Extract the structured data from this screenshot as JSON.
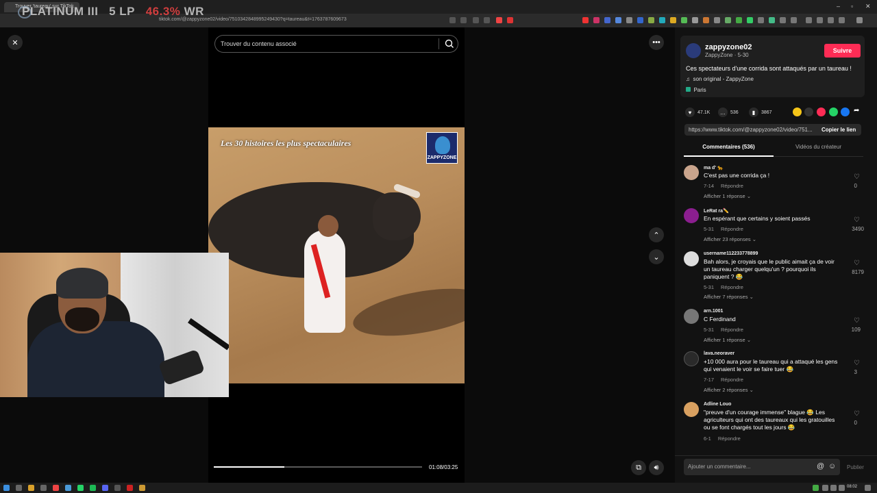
{
  "browser": {
    "tab_title": "Trouver 'taureau' sur TikTok",
    "url": "tiktok.com/@zappyzone02/video/7510342848995249430?q=taureau&t=1763787609673"
  },
  "stream_overlay": {
    "rank": "PLATINUM III",
    "lp": "5 LP",
    "wr_value": "46.3%",
    "wr_label": "WR"
  },
  "player": {
    "search_placeholder": "Trouver du contenu associé",
    "video_title": "Les 30 histoires les plus spectaculaires",
    "video_logo": "ZAPPYZONE",
    "time": "01:08/03:25",
    "progress": 0.34,
    "colors": {
      "accent": "#fe2c55",
      "background": "#000000"
    }
  },
  "post": {
    "author": "zappyzone02",
    "author_sub": "ZappyZone · 5-30",
    "follow_label": "Suivre",
    "description": "Ces spectateurs d'une corrida sont attaqués par un taureau !",
    "music": "son original - ZappyZone",
    "location": "Paris",
    "likes": "47.1K",
    "comments": "536",
    "saves": "3867",
    "link": "https://www.tiktok.com/@zappyzone02/video/751...",
    "copy_label": "Copier le lien"
  },
  "tabs": {
    "comments": "Commentaires (536)",
    "creator": "Vidéos du créateur"
  },
  "comments": [
    {
      "user": "ma d' 🐆",
      "text": "C'est pas une corrida ça !",
      "date": "7-14",
      "reply": "Répondre",
      "more": "Afficher 1 réponse ⌄",
      "likes": "0"
    },
    {
      "user": "LeRat ra✏️",
      "text": "En espérant que certains y soient passés",
      "date": "5-31",
      "reply": "Répondre",
      "more": "Afficher 23 réponses ⌄",
      "likes": "3490"
    },
    {
      "user": "username112233778899",
      "text": "Bah alors, je croyais que le public aimait ça de voir un taureau charger quelqu'un ? pourquoi ils paniquent ? 😂",
      "date": "5-31",
      "reply": "Répondre",
      "more": "Afficher 7 réponses ⌄",
      "likes": "8179"
    },
    {
      "user": "arn.1001",
      "text": "C Ferdinand",
      "date": "5-31",
      "reply": "Répondre",
      "more": "Afficher 1 réponse ⌄",
      "likes": "109"
    },
    {
      "user": "lava.neoraver",
      "text": "+10 000 aura pour le taureau qui a attaqué les gens qui venaient le voir se faire tuer 😂",
      "date": "7-17",
      "reply": "Répondre",
      "more": "Afficher 2 réponses ⌄",
      "likes": "3"
    },
    {
      "user": "Adline Louo",
      "text": "\"preuve d'un courage immense\" blague 😂 Les agriculteurs qui ont des taureaux qui les gratouilles ou se font chargés tout les jours 😂",
      "date": "6-1",
      "reply": "Répondre",
      "more": "",
      "likes": "0"
    }
  ],
  "comment_input": {
    "placeholder": "Ajouter un commentaire...",
    "publish": "Publier"
  },
  "taskbar": {
    "time": "08:02"
  }
}
